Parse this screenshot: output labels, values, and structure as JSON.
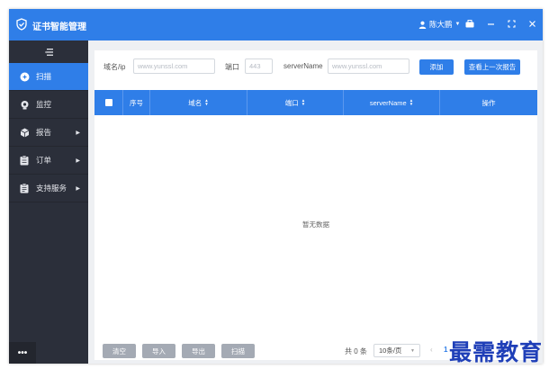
{
  "app": {
    "title": "证书智能管理"
  },
  "titlebar": {
    "user_name": "陈大鹏",
    "icons": [
      "user-icon",
      "briefcase-icon",
      "minimize-icon",
      "maximize-icon",
      "close-icon"
    ]
  },
  "sidebar": {
    "items": [
      {
        "label": "扫描",
        "icon": "scan-icon",
        "active": true
      },
      {
        "label": "监控",
        "icon": "monitor-icon",
        "active": false
      },
      {
        "label": "报告",
        "icon": "report-icon",
        "active": false,
        "submenu": true
      },
      {
        "label": "订单",
        "icon": "order-icon",
        "active": false,
        "submenu": true
      },
      {
        "label": "支持服务",
        "icon": "support-icon",
        "active": false,
        "submenu": true
      }
    ],
    "more_label": "•••"
  },
  "filters": {
    "domain_label": "域名/ip",
    "domain_placeholder": "www.yunssl.com",
    "port_label": "端口",
    "port_placeholder": "443",
    "servername_label": "serverName",
    "servername_placeholder": "www.yunssl.com",
    "add_button": "添加",
    "last_report_button": "查看上一次报告"
  },
  "table": {
    "headers": [
      "序号",
      "域名",
      "端口",
      "serverName",
      "操作"
    ],
    "empty_text": "暂无数据"
  },
  "footer": {
    "buttons": [
      "清空",
      "导入",
      "导出",
      "扫描"
    ],
    "total_text": "共 0 条",
    "page_size": "10条/页",
    "current_page": "1"
  },
  "watermark": "最需教育",
  "colors": {
    "accent": "#2f7ee8",
    "sidebar_bg": "#2b2f3a",
    "button_gray": "#a4aab4"
  }
}
